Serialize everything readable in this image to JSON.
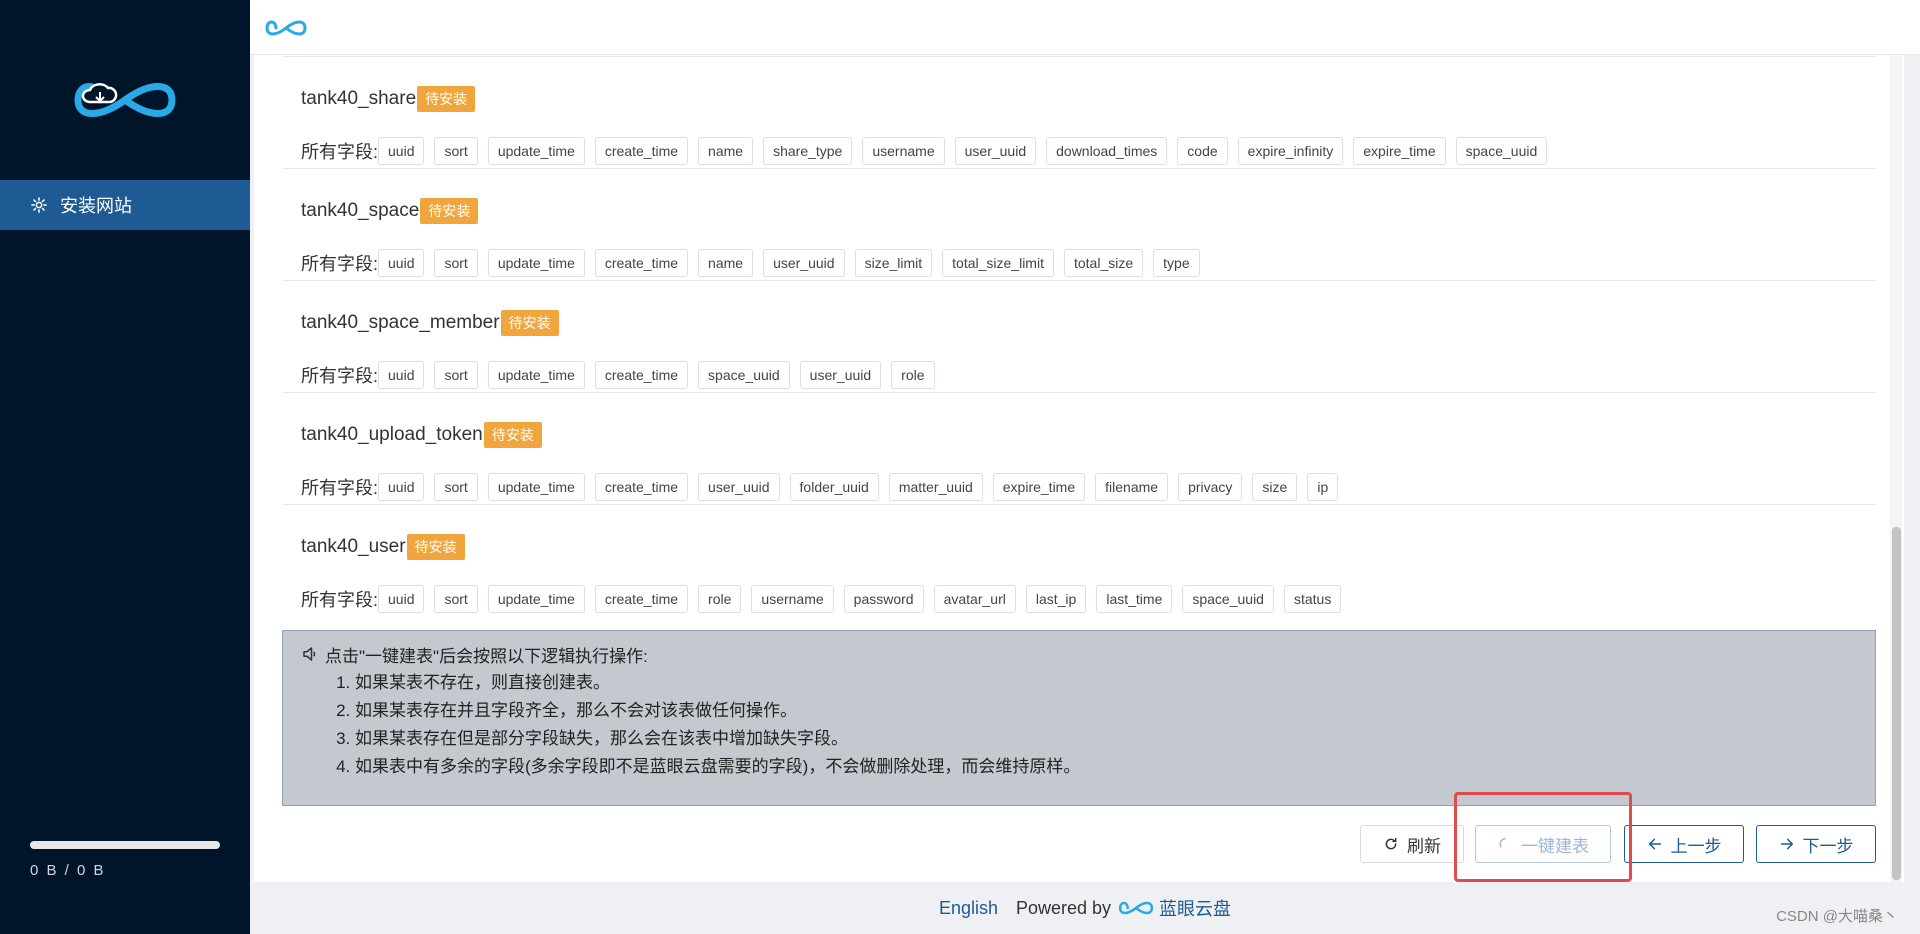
{
  "sidebar": {
    "nav_label": "安装网站",
    "progress": 0.0,
    "storage_text": "0 B / 0 B"
  },
  "tables": [
    {
      "name": "tank40_share",
      "status": "待安装",
      "fields_label": "所有字段:",
      "fields": [
        "uuid",
        "sort",
        "update_time",
        "create_time",
        "name",
        "share_type",
        "username",
        "user_uuid",
        "download_times",
        "code",
        "expire_infinity",
        "expire_time",
        "space_uuid"
      ]
    },
    {
      "name": "tank40_space",
      "status": "待安装",
      "fields_label": "所有字段:",
      "fields": [
        "uuid",
        "sort",
        "update_time",
        "create_time",
        "name",
        "user_uuid",
        "size_limit",
        "total_size_limit",
        "total_size",
        "type"
      ]
    },
    {
      "name": "tank40_space_member",
      "status": "待安装",
      "fields_label": "所有字段:",
      "fields": [
        "uuid",
        "sort",
        "update_time",
        "create_time",
        "space_uuid",
        "user_uuid",
        "role"
      ]
    },
    {
      "name": "tank40_upload_token",
      "status": "待安装",
      "fields_label": "所有字段:",
      "fields": [
        "uuid",
        "sort",
        "update_time",
        "create_time",
        "user_uuid",
        "folder_uuid",
        "matter_uuid",
        "expire_time",
        "filename",
        "privacy",
        "size",
        "ip"
      ]
    },
    {
      "name": "tank40_user",
      "status": "待安装",
      "fields_label": "所有字段:",
      "fields": [
        "uuid",
        "sort",
        "update_time",
        "create_time",
        "role",
        "username",
        "password",
        "avatar_url",
        "last_ip",
        "last_time",
        "space_uuid",
        "status"
      ]
    }
  ],
  "notice": {
    "heading": "点击\"一键建表\"后会按照以下逻辑执行操作:",
    "items": [
      "如果某表不存在，则直接创建表。",
      "如果某表存在并且字段齐全，那么不会对该表做任何操作。",
      "如果某表存在但是部分字段缺失，那么会在该表中增加缺失字段。",
      "如果表中有多余的字段(多余字段即不是蓝眼云盘需要的字段)，不会做删除处理，而会维持原样。"
    ]
  },
  "buttons": {
    "refresh": "刷新",
    "create": "一键建表",
    "prev": "上一步",
    "next": "下一步"
  },
  "footer": {
    "language": "English",
    "powered_by": "Powered by",
    "brand": "蓝眼云盘"
  },
  "watermark": "CSDN @大喵桑丶",
  "colors": {
    "sidebar_bg": "#001529",
    "nav_active": "#1e5a93",
    "badge": "#f0a63d",
    "accent": "#1e5a93",
    "highlight": "#e04b4b"
  }
}
